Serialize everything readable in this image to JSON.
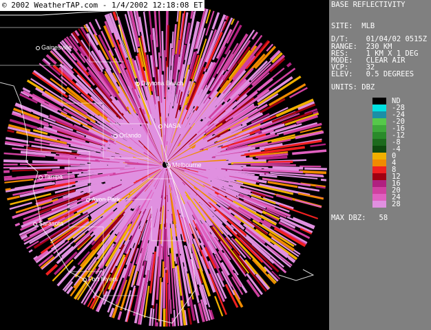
{
  "copyright": "© 2002 WeatherTAP.com - 1/4/2002 12:18:08  ET",
  "panel": {
    "title": "BASE REFLECTIVITY",
    "site": "SITE:  MLB",
    "datetime": "D/T:    01/04/02 0515Z",
    "range": "RANGE:  230 KM",
    "res": "RES:    1 KM X 1 DEG",
    "mode": "MODE:   CLEAR AIR",
    "vcp": "VCP:    32",
    "elev": "ELEV:   0.5 DEGREES",
    "units": "UNITS: DBZ",
    "max": "MAX DBZ:   58"
  },
  "legend": [
    {
      "label": "ND",
      "color": "#000000"
    },
    {
      "label": "-28",
      "color": "#00e0e0"
    },
    {
      "label": "-24",
      "color": "#1a8fa6"
    },
    {
      "label": "-20",
      "color": "#56c84a"
    },
    {
      "label": "-16",
      "color": "#3ea83a"
    },
    {
      "label": "-12",
      "color": "#2a8a2a"
    },
    {
      "label": "-8",
      "color": "#1d6a1d"
    },
    {
      "label": "-4",
      "color": "#0f4a0f"
    },
    {
      "label": "0",
      "color": "#f0b000"
    },
    {
      "label": "4",
      "color": "#f08a00"
    },
    {
      "label": "8",
      "color": "#f02020"
    },
    {
      "label": "12",
      "color": "#a00010"
    },
    {
      "label": "16",
      "color": "#b02080"
    },
    {
      "label": "20",
      "color": "#d040a0"
    },
    {
      "label": "24",
      "color": "#e060c0"
    },
    {
      "label": "28",
      "color": "#e090e0"
    }
  ],
  "cities": [
    {
      "name": "Gainesville"
    },
    {
      "name": "Daytona Beach"
    },
    {
      "name": "NASA"
    },
    {
      "name": "Orlando"
    },
    {
      "name": "Melbourne"
    },
    {
      "name": "Tampa"
    },
    {
      "name": "Avon Park"
    },
    {
      "name": "Sarasota"
    },
    {
      "name": "Fort Myers"
    }
  ]
}
